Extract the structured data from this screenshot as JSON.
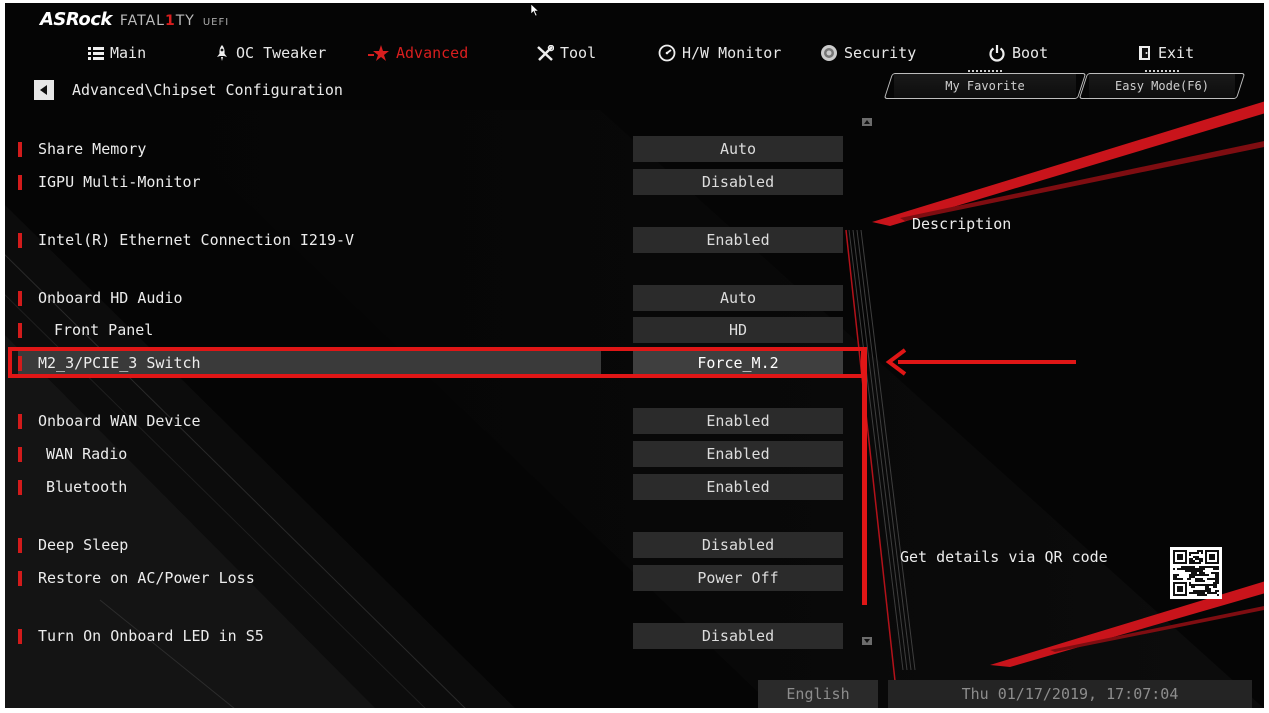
{
  "brand": {
    "name": "ASRock",
    "series_pre": "FATAL",
    "series_one": "1",
    "series_post": "TY",
    "uefi": "UEFI"
  },
  "tabs": [
    {
      "label": "Main",
      "icon": "list-icon"
    },
    {
      "label": "OC Tweaker",
      "icon": "rocket-icon"
    },
    {
      "label": "Advanced",
      "icon": "star-icon",
      "active": true
    },
    {
      "label": "Tool",
      "icon": "tools-icon"
    },
    {
      "label": "H/W Monitor",
      "icon": "monitor-icon"
    },
    {
      "label": "Security",
      "icon": "shield-icon"
    },
    {
      "label": "Boot",
      "icon": "power-icon"
    },
    {
      "label": "Exit",
      "icon": "exit-door-icon"
    }
  ],
  "breadcrumb": "Advanced\\Chipset Configuration",
  "buttons": {
    "favorite": "My Favorite",
    "easy_mode": "Easy Mode(F6)"
  },
  "settings": [
    {
      "label": "Share Memory",
      "value": "Auto"
    },
    {
      "label": "IGPU Multi-Monitor",
      "value": "Disabled"
    },
    {
      "label": "Intel(R) Ethernet Connection I219-V",
      "value": "Enabled"
    },
    {
      "label": "Onboard HD Audio",
      "value": "Auto"
    },
    {
      "label": "Front Panel",
      "value": "HD"
    },
    {
      "label": "M2_3/PCIE_3 Switch",
      "value": "Force_M.2",
      "selected": true
    },
    {
      "label": "Onboard WAN Device",
      "value": "Enabled"
    },
    {
      "label": "WAN Radio",
      "value": "Enabled"
    },
    {
      "label": "Bluetooth",
      "value": "Enabled"
    },
    {
      "label": "Deep Sleep",
      "value": "Disabled"
    },
    {
      "label": "Restore on AC/Power Loss",
      "value": "Power Off"
    },
    {
      "label": "Turn On Onboard LED in S5",
      "value": "Disabled"
    }
  ],
  "description": {
    "title": "Description",
    "qr_text": "Get details via QR code"
  },
  "footer": {
    "language": "English",
    "datetime": "Thu 01/17/2019, 17:07:04"
  },
  "colors": {
    "accent": "#d81e1e",
    "annotation": "#e01616",
    "background": "#050505"
  }
}
